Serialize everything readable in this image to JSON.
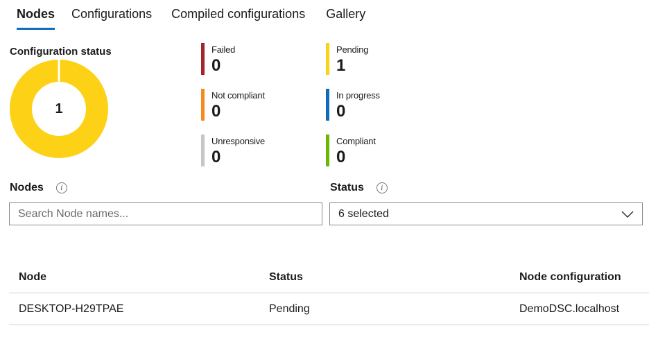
{
  "tabs": [
    {
      "label": "Nodes",
      "active": true
    },
    {
      "label": "Configurations",
      "active": false
    },
    {
      "label": "Compiled configurations",
      "active": false
    },
    {
      "label": "Gallery",
      "active": false
    }
  ],
  "config_status": {
    "title": "Configuration status",
    "total": "1",
    "donut_color": "#fcd116",
    "stats": [
      {
        "label": "Failed",
        "value": "0",
        "color": "#a4262c"
      },
      {
        "label": "Pending",
        "value": "1",
        "color": "#fcd116"
      },
      {
        "label": "Not compliant",
        "value": "0",
        "color": "#f7891f"
      },
      {
        "label": "In progress",
        "value": "0",
        "color": "#0f6cbd"
      },
      {
        "label": "Unresponsive",
        "value": "0",
        "color": "#c8c6c4"
      },
      {
        "label": "Compliant",
        "value": "0",
        "color": "#6bb700"
      }
    ]
  },
  "filters": {
    "nodes_label": "Nodes",
    "search_placeholder": "Search Node names...",
    "status_label": "Status",
    "status_value": "6 selected"
  },
  "table": {
    "headers": [
      "Node",
      "Status",
      "Node configuration"
    ],
    "rows": [
      [
        "DESKTOP-H29TPAE",
        "Pending",
        "DemoDSC.localhost"
      ]
    ]
  },
  "icons": {
    "info": "info-icon",
    "dropdown": "chevron-down-icon"
  }
}
